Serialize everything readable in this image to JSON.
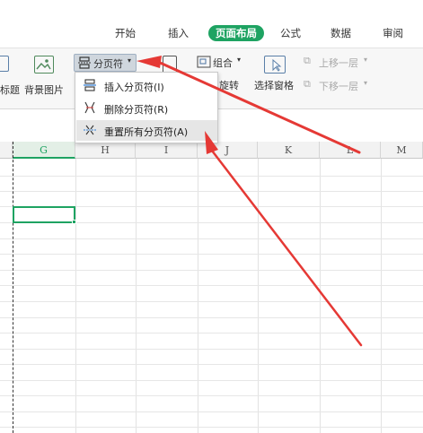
{
  "tabs": [
    {
      "label": "开始",
      "active": false
    },
    {
      "label": "插入",
      "active": false
    },
    {
      "label": "页面布局",
      "active": true
    },
    {
      "label": "公式",
      "active": false
    },
    {
      "label": "数据",
      "active": false
    },
    {
      "label": "审阅",
      "active": false
    }
  ],
  "ribbon": {
    "print_titles_partial": "标题",
    "background_image": "背景图片",
    "page_break_button": "分页符",
    "group_button": "组合",
    "rotate_partial": "旋转",
    "selection_pane": "选择窗格",
    "bring_forward": "上移一层",
    "send_backward": "下移一层"
  },
  "menu": {
    "items": [
      {
        "label": "插入分页符(I)",
        "icon": "insert-page-break-icon"
      },
      {
        "label": "删除分页符(R)",
        "icon": "delete-page-break-icon"
      },
      {
        "label": "重置所有分页符(A)",
        "icon": "reset-page-breaks-icon",
        "highlighted": true
      }
    ]
  },
  "grid": {
    "columns": [
      "G",
      "H",
      "I",
      "J",
      "K",
      "L",
      "M"
    ],
    "selected_column": "G"
  },
  "colors": {
    "accent_green": "#1ea362",
    "annotation_red": "#e53935"
  }
}
